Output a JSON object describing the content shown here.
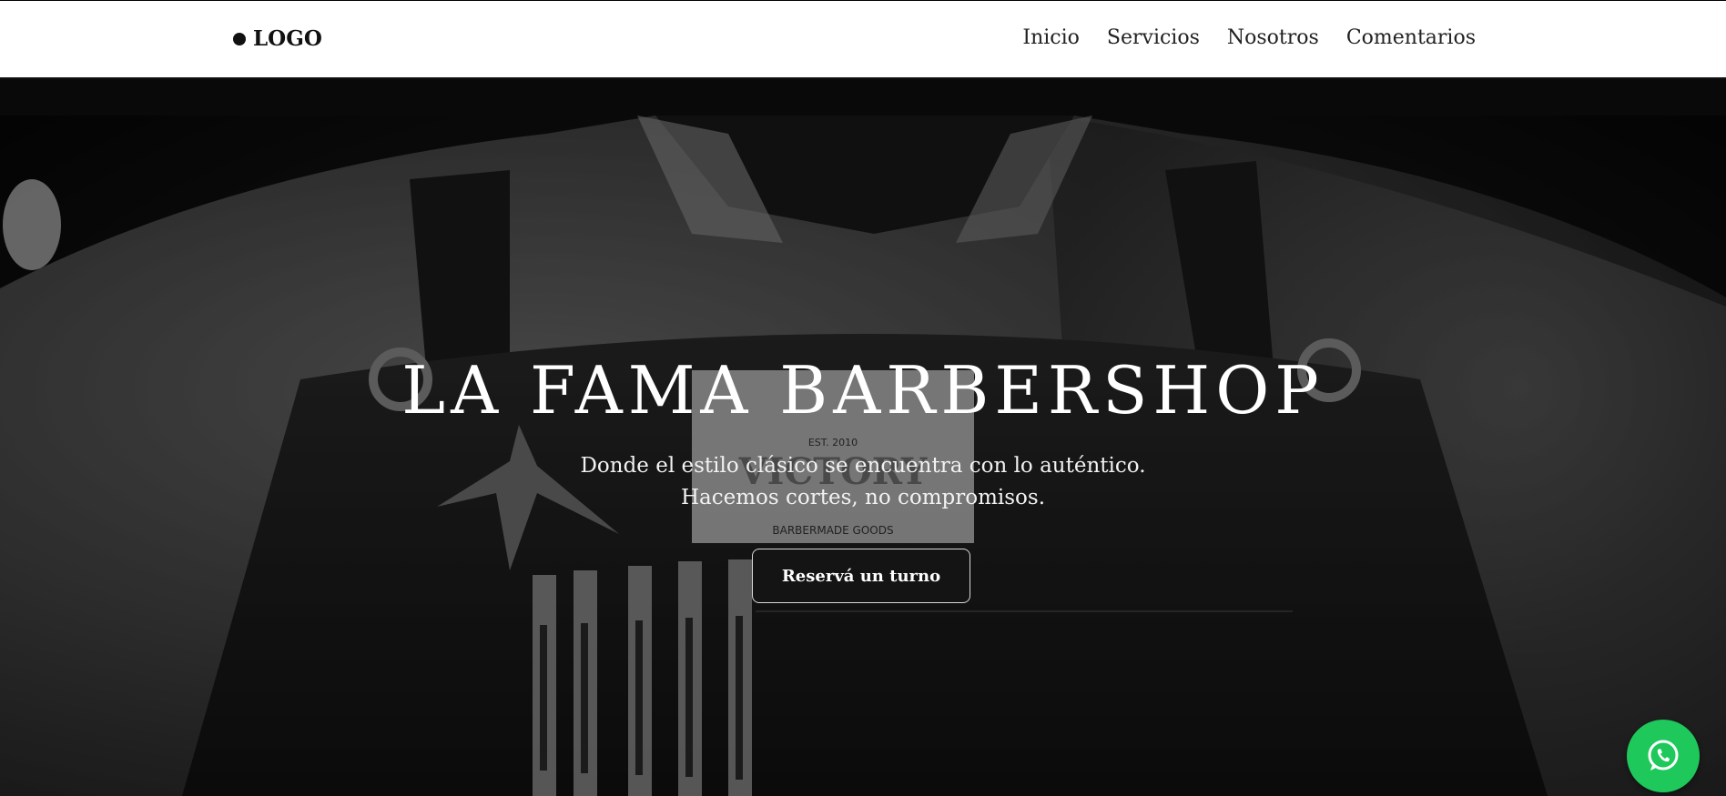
{
  "header": {
    "logo_text": "LOGO",
    "nav": [
      {
        "label": "Inicio"
      },
      {
        "label": "Servicios"
      },
      {
        "label": "Nosotros"
      },
      {
        "label": "Comentarios"
      }
    ]
  },
  "hero": {
    "title": "LA FAMA BARBERSHOP",
    "subtitle_line1": "Donde el estilo clásico se encuentra con lo auténtico.",
    "subtitle_line2": "Hacemos cortes, no compromisos.",
    "cta_label": "Reservá un turno",
    "background_image_text": {
      "est": "EST. 2010",
      "brand": "VICTORY",
      "goods": "BARBERMADE GOODS"
    }
  },
  "floating": {
    "whatsapp_icon": "whatsapp-icon",
    "accent_color": "#1ec85b"
  }
}
